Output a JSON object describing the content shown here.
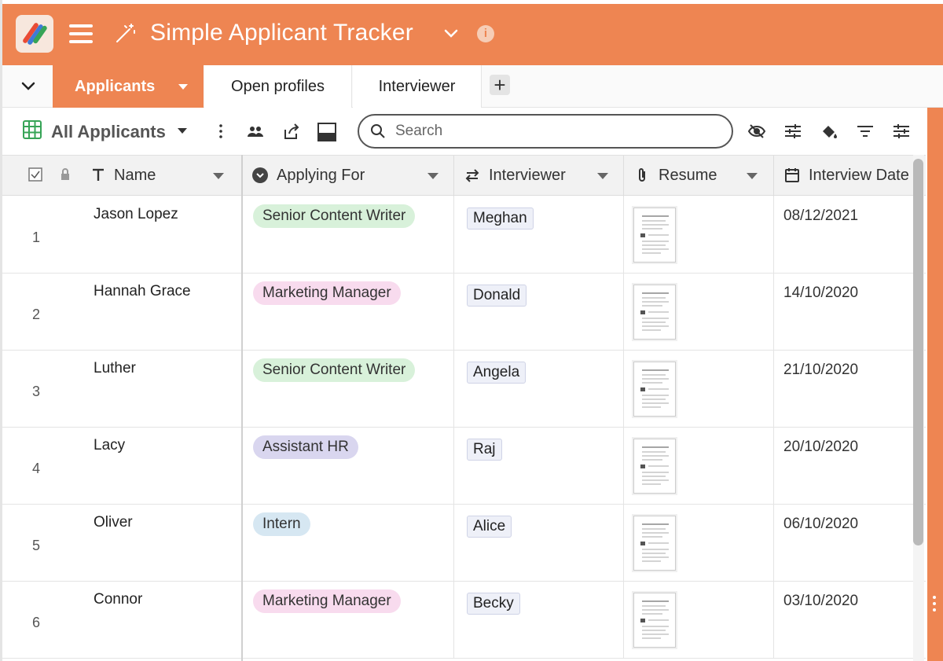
{
  "app": {
    "title": "Simple Applicant Tracker",
    "accent_color": "#ee8552",
    "icons": {
      "logo": "stackby-logo",
      "menu": "hamburger-icon",
      "wand": "magic-wand-icon",
      "title_dropdown": "chevron-down-icon",
      "info": "info-icon"
    }
  },
  "tabs": {
    "collapse_icon": "chevron-down-icon",
    "items": [
      {
        "label": "Applicants",
        "active": true
      },
      {
        "label": "Open profiles",
        "active": false
      },
      {
        "label": "Interviewer",
        "active": false
      }
    ],
    "add_label": "+"
  },
  "toolbar": {
    "view_name": "All Applicants",
    "search_placeholder": "Search",
    "icons": [
      "grid-view-icon",
      "more-vertical-icon",
      "people-icon",
      "share-icon",
      "row-height-icon",
      "hide-fields-icon",
      "sliders-icon",
      "paint-bucket-icon",
      "filter-icon",
      "sort-icon"
    ]
  },
  "table": {
    "columns": [
      {
        "label": "Name",
        "icon": "text-type-icon"
      },
      {
        "label": "Applying For",
        "icon": "single-select-icon"
      },
      {
        "label": "Interviewer",
        "icon": "link-arrows-icon"
      },
      {
        "label": "Resume",
        "icon": "paperclip-icon"
      },
      {
        "label": "Interview Date",
        "icon": "calendar-icon"
      }
    ],
    "rows": [
      {
        "num": "1",
        "name": "Jason Lopez",
        "role": "Senior Content Writer",
        "role_color": "#d8f1da",
        "interviewer": "Meghan",
        "date": "08/12/2021"
      },
      {
        "num": "2",
        "name": "Hannah Grace",
        "role": "Marketing Manager",
        "role_color": "#f8dbee",
        "interviewer": "Donald",
        "date": "14/10/2020"
      },
      {
        "num": "3",
        "name": "Luther",
        "role": "Senior Content Writer",
        "role_color": "#d8f1da",
        "interviewer": "Angela",
        "date": "21/10/2020"
      },
      {
        "num": "4",
        "name": "Lacy",
        "role": "Assistant HR",
        "role_color": "#d9d6ef",
        "interviewer": "Raj",
        "date": "20/10/2020"
      },
      {
        "num": "5",
        "name": "Oliver",
        "role": "Intern",
        "role_color": "#d6e7f2",
        "interviewer": "Alice",
        "date": "06/10/2020"
      },
      {
        "num": "6",
        "name": "Connor",
        "role": "Marketing Manager",
        "role_color": "#f8dbee",
        "interviewer": "Becky",
        "date": "03/10/2020"
      }
    ]
  }
}
